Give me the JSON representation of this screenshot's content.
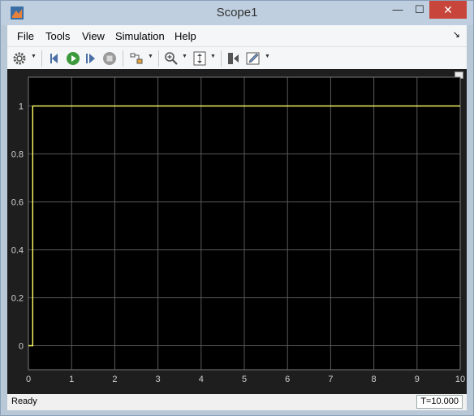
{
  "window": {
    "title": "Scope1",
    "minimize_glyph": "—",
    "maximize_glyph": "☐",
    "close_glyph": "✕"
  },
  "menu": {
    "items": [
      "File",
      "Tools",
      "View",
      "Simulation",
      "Help"
    ],
    "overflow_glyph": "↘"
  },
  "toolbar": {
    "icons": [
      "settings-icon",
      "step-back-icon",
      "run-icon",
      "step-forward-icon",
      "stop-icon",
      "signal-select-icon",
      "zoom-in-icon",
      "scale-axes-icon",
      "restore-view-icon",
      "edit-icon"
    ]
  },
  "colors": {
    "plot_background": "#000000",
    "frame_background": "#1e1e1e",
    "grid": "#5a5a5a",
    "tick_label": "#d0d0d0",
    "signal": "#ffff66"
  },
  "chart_data": {
    "type": "line",
    "title": "",
    "xlabel": "",
    "ylabel": "",
    "xlim": [
      0,
      10
    ],
    "ylim": [
      -0.1,
      1.12
    ],
    "xticks": [
      0,
      1,
      2,
      3,
      4,
      5,
      6,
      7,
      8,
      9,
      10
    ],
    "yticks": [
      0,
      0.2,
      0.4,
      0.6,
      0.8,
      1
    ],
    "ytick_labels": [
      "0",
      "0.2",
      "0.4",
      "0.6",
      "0.8",
      "1"
    ],
    "grid": true,
    "series": [
      {
        "x": [
          0,
          0.1,
          0.1,
          10
        ],
        "y": [
          0,
          0,
          1,
          1
        ]
      }
    ]
  },
  "status": {
    "text": "Ready",
    "time": "T=10.000"
  }
}
